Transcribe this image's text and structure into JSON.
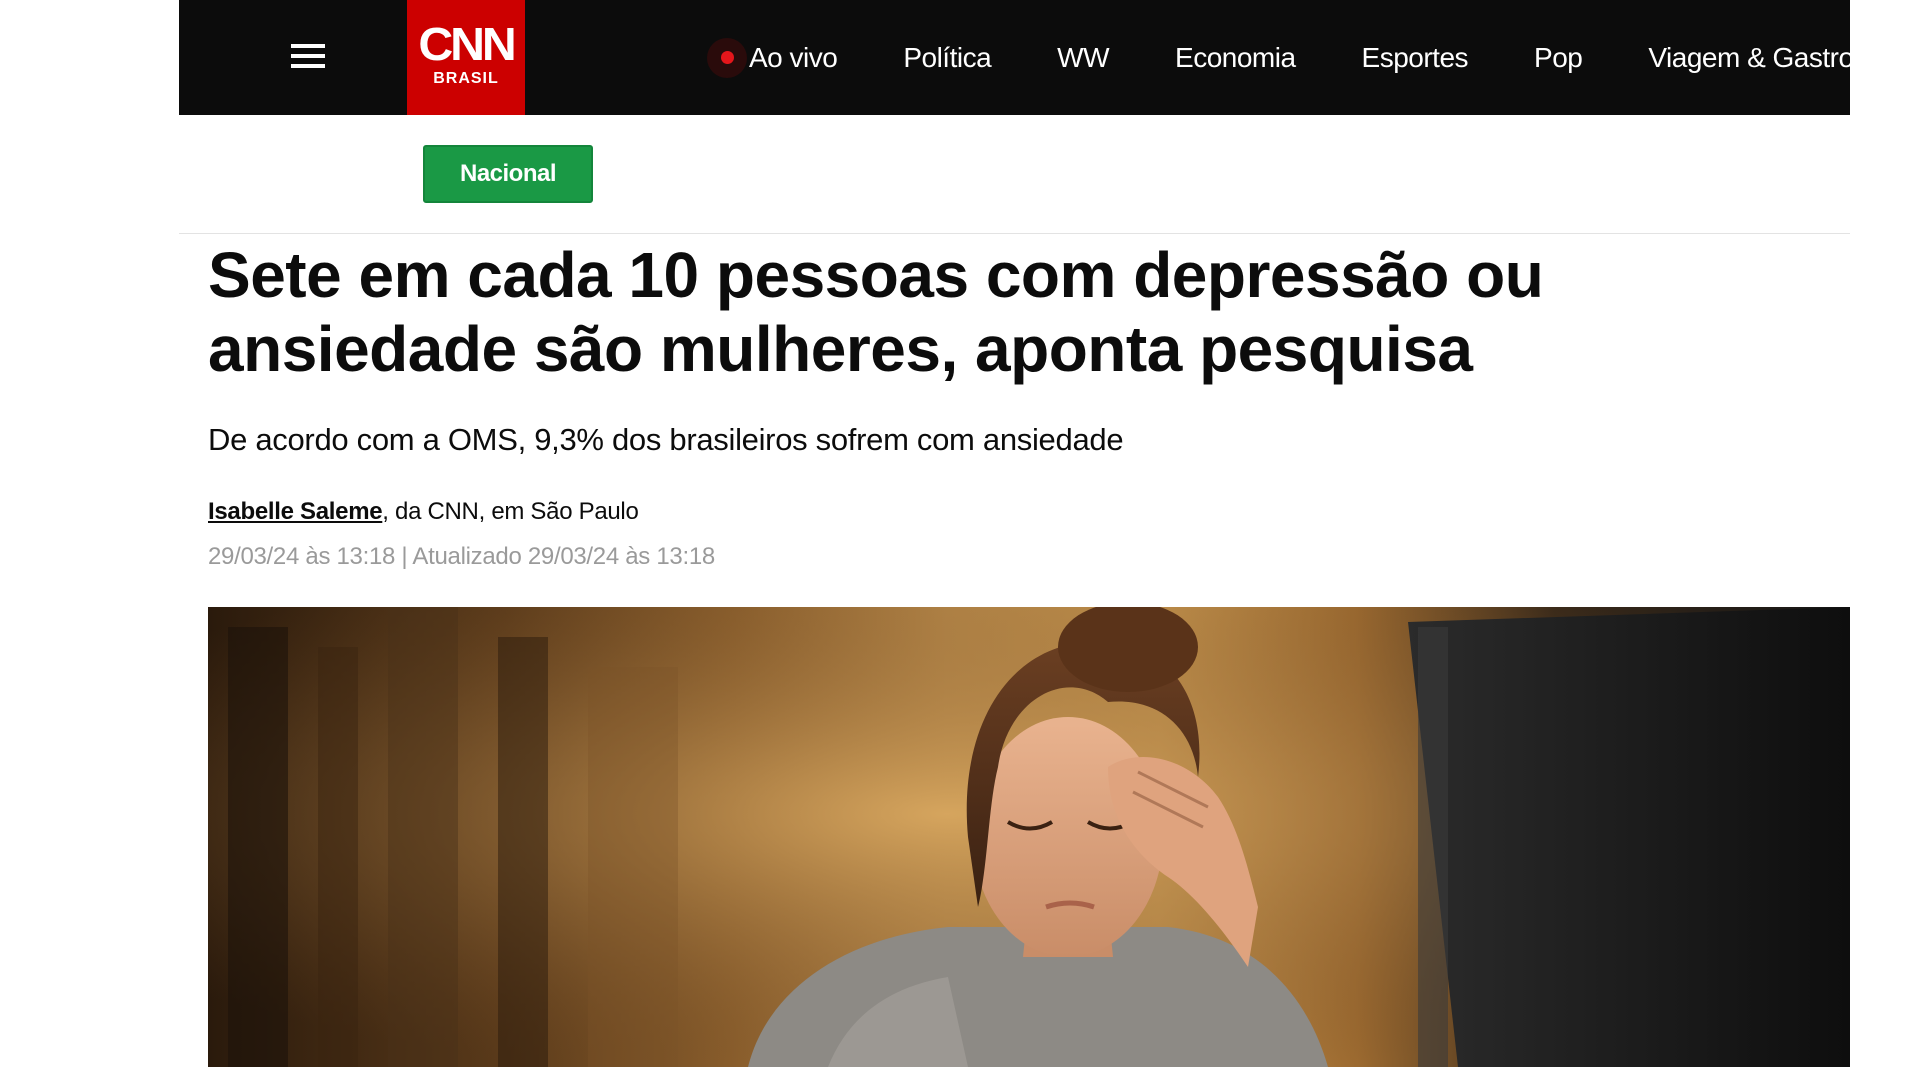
{
  "header": {
    "menu_icon": "hamburger-menu-icon",
    "logo": {
      "mark": "CNN",
      "sub": "BRASIL",
      "color": "#cc0000"
    },
    "nav_items": [
      {
        "label": "Ao vivo",
        "live": true
      },
      {
        "label": "Política"
      },
      {
        "label": "WW"
      },
      {
        "label": "Economia"
      },
      {
        "label": "Esportes"
      },
      {
        "label": "Pop"
      },
      {
        "label": "Viagem & Gastronomia"
      }
    ]
  },
  "article": {
    "section": "Nacional",
    "section_color": "#1a9945",
    "headline": "Sete em cada 10 pessoas com depressão ou ansiedade são mulheres, aponta pesquisa",
    "subheadline": "De acordo com a OMS, 9,3% dos brasileiros sofrem com ansiedade",
    "author": "Isabelle Saleme",
    "byline_suffix": ", da CNN, em São Paulo",
    "timestamp": "29/03/24 às 13:18 | Atualizado 29/03/24 às 13:18"
  }
}
